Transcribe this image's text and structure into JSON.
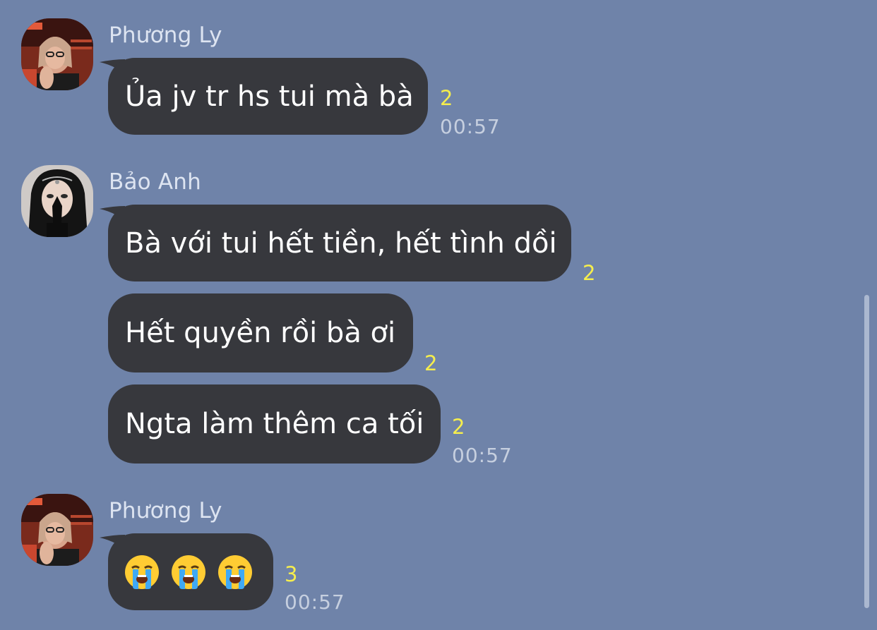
{
  "messages": [
    {
      "sender": "Phương Ly",
      "text": "Ủa jv tr hs tui mà bà",
      "unread": "2",
      "time": "00:57"
    },
    {
      "sender": "Bảo Anh",
      "bubbles": [
        {
          "text": "Bà với tui hết tiền, hết tình dồi",
          "unread": "2"
        },
        {
          "text": "Hết quyền rồi bà ơi",
          "unread": "2"
        },
        {
          "text": "Ngta làm thêm ca tối",
          "unread": "2",
          "time": "00:57"
        }
      ]
    },
    {
      "sender": "Phương Ly",
      "emojis": [
        "loudly-crying-face-emoji",
        "loudly-crying-face-emoji",
        "loudly-crying-face-emoji"
      ],
      "unread": "3",
      "time": "00:57"
    }
  ],
  "colors": {
    "background": "#6f83a9",
    "bubble": "#37383d",
    "unread": "#f5ed4d",
    "time": "#c6cfdf"
  }
}
